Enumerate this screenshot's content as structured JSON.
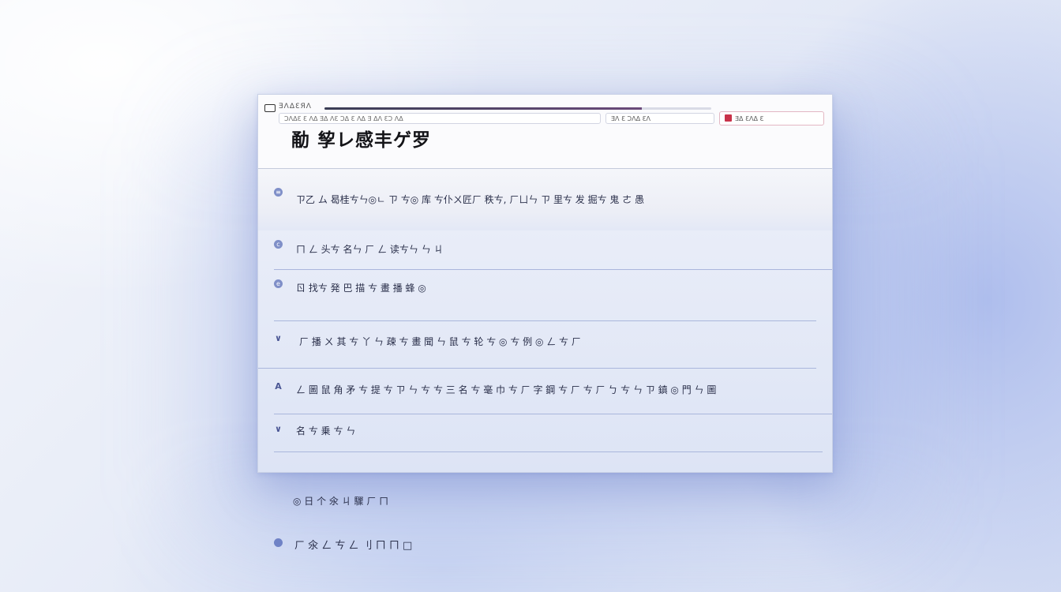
{
  "toolbar": {
    "crumbs": "ƎΛΔƐЯΛ",
    "search_text": "ƆΛΔƐ Ɛ ΛΔ ƎΔ ΛƐ ƆΔ Ɛ ΛΔ Ǝ ΔΛ ƐƆ ΛΔ",
    "filter_label": "ƎΛ Ɛ ƆΛΔ ƐΛ",
    "action_label": "ƎΔ ƐΛΔ Ɛ",
    "progress": 0.82
  },
  "page": {
    "title": "勈 孧レ感丰ゲ罗"
  },
  "rows": [
    {
      "marker": "≡",
      "label": "ㄗ乙 ム 曷桂ㄘㄣ◎ㄴ ㄗ ㄘ◎ 库 ㄘ仆ㄨ匠ㄏ 秩ㄘ, ㄏㄩㄣ ㄗ 里ㄘ 发 掘ㄘ 鬼 ㄜ 愚"
    },
    {
      "marker": "c",
      "label": "ㄇ ㄥ 头ㄘ 名ㄣ ㄏ ㄥ 读ㄘㄣ ㄣ ㄐ"
    },
    {
      "marker": "e",
      "label": "ㄖ 找ㄘ 発 巴 描 ㄘ 畫 播 蜂 ◎"
    },
    {
      "marker": "∨",
      "label": "ㄏ 播 ㄨ 其 ㄘ 丫 ㄣ 疎 ㄘ 畫 聞 ㄣ 鼠 ㄘ 轮 ㄘ ◎ ㄘ 例 ◎ ㄥ ㄘ ㄏ"
    },
    {
      "marker": "A",
      "label": "ㄥ 圖 鼠 角 矛 ㄘ 提 ㄘ ㄗ ㄣ ㄘ ㄘ 三 名 ㄘ 毫 巾 ㄘ ㄏ 字 鋼 ㄘ ㄏ ㄘ ㄏ ㄅ ㄘ ㄣ ㄗ 鎮 ◎ 門 ㄣ 圖"
    },
    {
      "marker": "∨",
      "label": "名 ㄘ 乗 ㄘ ㄣ"
    }
  ],
  "outside": [
    {
      "label": "◎ 日 个 氽 ㄐ 驟 ㄏ ㄇ"
    },
    {
      "label": "ㄏ 氽 ㄥ ㄘ ㄥ 刂 ㄇ ㄇ □"
    }
  ]
}
